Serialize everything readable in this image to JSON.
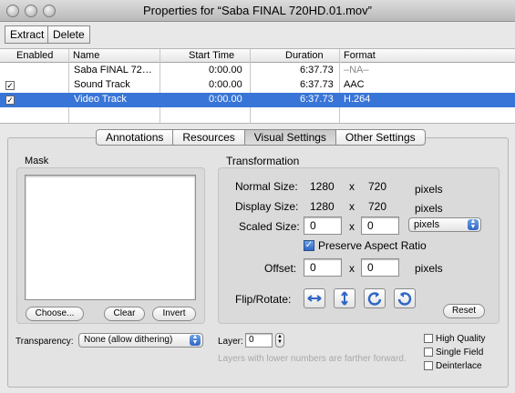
{
  "window": {
    "title": "Properties for “Saba FINAL 720HD.01.mov”"
  },
  "toolbar": {
    "extract_label": "Extract",
    "delete_label": "Delete"
  },
  "table": {
    "headers": {
      "enabled": "Enabled",
      "name": "Name",
      "start": "Start Time",
      "duration": "Duration",
      "format": "Format"
    },
    "rows": [
      {
        "enabled": false,
        "check": "",
        "name": "Saba FINAL 72…",
        "start": "0:00.00",
        "duration": "6:37.73",
        "format": "–NA–"
      },
      {
        "enabled": true,
        "check": "✓",
        "name": "Sound Track",
        "start": "0:00.00",
        "duration": "6:37.73",
        "format": "AAC"
      },
      {
        "enabled": true,
        "check": "✓",
        "name": "Video Track",
        "start": "0:00.00",
        "duration": "6:37.73",
        "format": "H.264"
      }
    ]
  },
  "tabs": [
    "Annotations",
    "Resources",
    "Visual Settings",
    "Other Settings"
  ],
  "mask": {
    "title": "Mask",
    "choose_label": "Choose...",
    "clear_label": "Clear",
    "invert_label": "Invert"
  },
  "transparency": {
    "label": "Transparency:",
    "value": "None (allow dithering)"
  },
  "layer": {
    "label": "Layer:",
    "value": "0",
    "hint": "Layers with lower numbers are farther forward."
  },
  "transformation": {
    "title": "Transformation",
    "normal_label": "Normal Size:",
    "normal_w": "1280",
    "normal_h": "720",
    "display_label": "Display Size:",
    "display_w": "1280",
    "display_h": "720",
    "scaled_label": "Scaled Size:",
    "scaled_w": "0",
    "scaled_h": "0",
    "times": "x",
    "pixels": "pixels",
    "units_value": "pixels",
    "preserve_label": "Preserve Aspect Ratio",
    "preserve_checked": true,
    "offset_label": "Offset:",
    "offset_x": "0",
    "offset_y": "0",
    "flip_label": "Flip/Rotate:",
    "reset_label": "Reset"
  },
  "options": {
    "high_quality": "High Quality",
    "single_field": "Single Field",
    "deinterlace": "Deinterlace"
  },
  "colors": {
    "selection": "#3875d7",
    "accent_check": "#2f66c6"
  }
}
